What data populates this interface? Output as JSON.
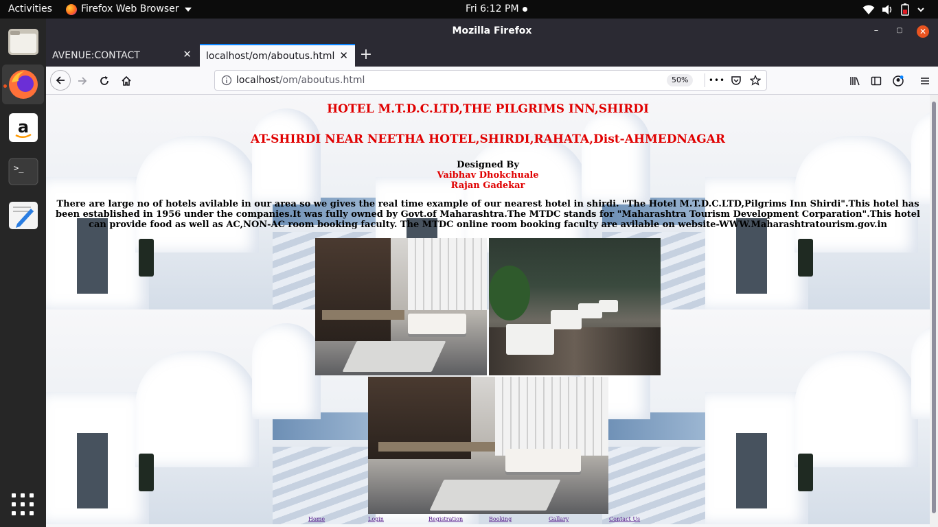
{
  "topbar": {
    "activities": "Activities",
    "app_menu": "Firefox Web Browser",
    "clock": "Fri  6:12 PM",
    "icons": [
      "wifi-icon",
      "volume-icon",
      "battery-icon",
      "power-menu-icon"
    ]
  },
  "dock": {
    "apps": [
      "files-icon",
      "firefox-icon",
      "amazon-icon",
      "terminal-icon",
      "text-editor-icon"
    ],
    "grid_button": "show-applications-icon"
  },
  "window": {
    "title": "Mozilla Firefox",
    "minimize": "–",
    "maximize": "▢",
    "close": "✕"
  },
  "tabs": [
    {
      "label": "AVENUE:CONTACT",
      "close": "✕"
    },
    {
      "label": "localhost/om/aboutus.html",
      "close": "✕"
    }
  ],
  "new_tab": "+",
  "navbar": {
    "url_host": "localhost",
    "url_path": "/om/aboutus.html",
    "zoom": "50%",
    "more": "•••"
  },
  "page": {
    "heading1": "HOTEL M.T.D.C.LTD,THE PILGRIMS INN,SHIRDI",
    "heading2": "AT-SHIRDI NEAR NEETHA HOTEL,SHIRDI,RAHATA,Dist-AHMEDNAGAR",
    "designed_by": "Designed By",
    "designers": [
      "Vaibhav Dhokchuale",
      "Rajan Gadekar"
    ],
    "paragraph": "There are large no of hotels avilable in our area so we gives the real time example of our nearest hotel in shirdi. \"The Hotel M.T.D.C.LTD,Pilgrims Inn Shirdi\".This hotel has been established in 1956 under the companies.It was fully owned by Govt.of Maharashtra.The MTDC stands for \"Maharashtra Tourism Development Corparation\".This hotel can provide food as well as AC,NON-AC room booking faculty. The MTDC online room booking faculty are avilable on website-WWW.Maharashtratourism.gov.in",
    "footer_links": [
      "Home",
      "Login",
      "Registration",
      "Booking",
      "Gallary",
      "Contact Us"
    ]
  },
  "colors": {
    "heading": "#e00000",
    "ubuntu_orange": "#e95420",
    "link": "#551a8b"
  }
}
